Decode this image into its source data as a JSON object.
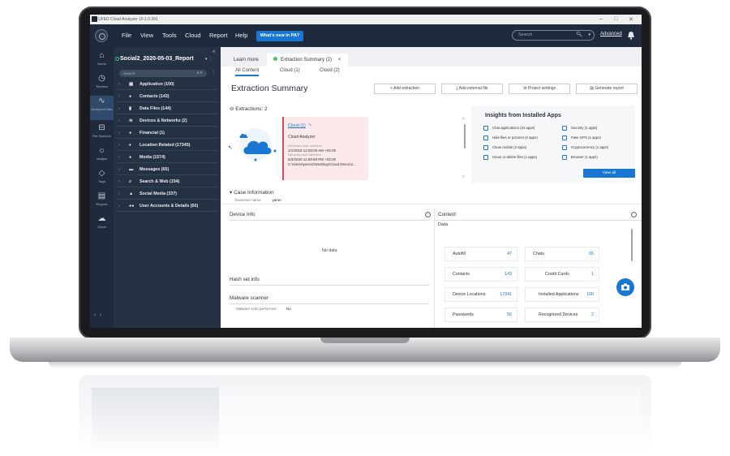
{
  "app": {
    "title": "UFED Cloud Analyzer 10.1.0.391"
  },
  "menu": {
    "items": [
      "File",
      "View",
      "Tools",
      "Cloud",
      "Report",
      "Help"
    ],
    "whats_new": "What's new in PA?",
    "search_placeholder": "Search",
    "advanced": "Advanced"
  },
  "rail": {
    "items": [
      "Home",
      "Timeline",
      "Analyzed Data",
      "File Systems",
      "Insights",
      "Tags",
      "Reports",
      "Cloud"
    ]
  },
  "tree": {
    "case_name": "Social2_2020-05-03_Report",
    "search_placeholder": "Search",
    "items": [
      "Application (100)",
      "Contacts (143)",
      "Data Files (144)",
      "Devices & Networks (2)",
      "Financial (1)",
      "Location Related (17345)",
      "Media (1574)",
      "Messages (65)",
      "Search & Web (154)",
      "Social Media (337)",
      "User Accounts & Details (60)"
    ]
  },
  "tabs": {
    "learn_more": "Learn more",
    "extraction_summary": "Extraction Summary (2)"
  },
  "subtabs": [
    "All Content",
    "Cloud (1)",
    "Cloud (2)"
  ],
  "header": {
    "title": "Extraction Summary",
    "buttons": [
      "Add extraction",
      "Add external file",
      "Project settings",
      "Generate report"
    ]
  },
  "extractions": {
    "label": "Extractions: 2",
    "link": "Cloud (1)",
    "analyzer": "Cloud Analyzer",
    "start_label": "Extraction start date/time",
    "start": "1/1/2018 12:00:00 AM +02:00",
    "end_label": "Extraction end date/time",
    "end": "5/3/2020 11:59:59 PM +02:00",
    "path": "C:\\Users\\yaronz\\Desktop\\Cloud Demo\\2..."
  },
  "insights": {
    "title": "Insights from Installed Apps",
    "items": [
      "Chat applications (22 apps)",
      "Security (1 apps)",
      "Hide files or pictures (2 apps)",
      "Fake GPS (1 apps)",
      "Clean mobile (2 apps)",
      "Cryptocurrency (1 apps)",
      "Clean or delete files (1 apps)",
      "Browser (1 apps)"
    ],
    "view_all": "View all"
  },
  "case_info": {
    "title": "Case Information",
    "examiner_label": "Examiner name",
    "examiner": "yaron"
  },
  "device_info": {
    "title": "Device Info",
    "no_data": "No data",
    "hash_title": "Hash set info",
    "malware_title": "Malware scanner",
    "malware_label": "Malware scan performed",
    "malware_value": "No"
  },
  "content": {
    "title": "Content",
    "data_label": "Data",
    "cells": [
      {
        "label": "Autofill",
        "value": "47"
      },
      {
        "label": "Chats",
        "value": "65"
      },
      {
        "label": "Contacts",
        "value": "143"
      },
      {
        "label": "Credit Cards",
        "value": "1"
      },
      {
        "label": "Device Locations",
        "value": "17341"
      },
      {
        "label": "Installed Applications",
        "value": "100"
      },
      {
        "label": "Passwords",
        "value": "56"
      },
      {
        "label": "Recognized Devices",
        "value": "2"
      }
    ]
  },
  "colors": {
    "accent": "#1976d2",
    "sidebar": "#1f2b3c",
    "tree": "#243244"
  }
}
